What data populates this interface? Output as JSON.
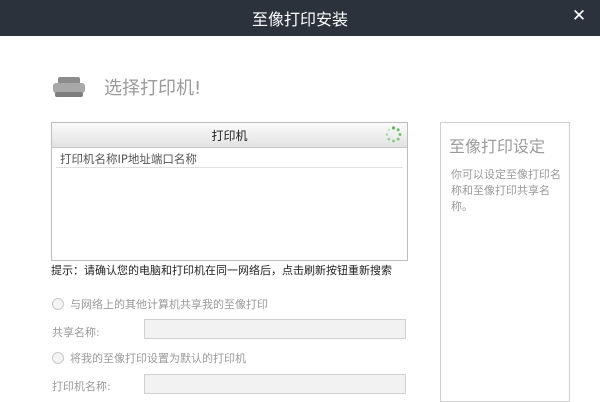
{
  "window": {
    "title": "至像打印安装",
    "close_icon": "close-icon"
  },
  "heading": {
    "text": "选择打印机!",
    "icon": "printer-icon"
  },
  "printer_list": {
    "header": "打印机",
    "refresh_icon": "refresh-icon",
    "columns_text": "打印机名称IP地址端口名称",
    "rows": []
  },
  "tip": "提示：请确认您的电脑和打印机在同一网络后，点击刷新按钮重新搜索",
  "options": {
    "share_label": "与网络上的其他计算机共享我的至像打印",
    "share_name_label": "共享名称:",
    "share_name_value": "",
    "default_label": "将我的至像打印设置为默认的打印机",
    "printer_name_label": "打印机名称:",
    "printer_name_value": ""
  },
  "side": {
    "title": "至像打印设定",
    "description": "你可以设定至像打印名称和至像打印共享名称。"
  },
  "colors": {
    "titlebar": "#2b323c",
    "accent_green": "#5cb85c",
    "muted_text": "#9a9a9a"
  }
}
